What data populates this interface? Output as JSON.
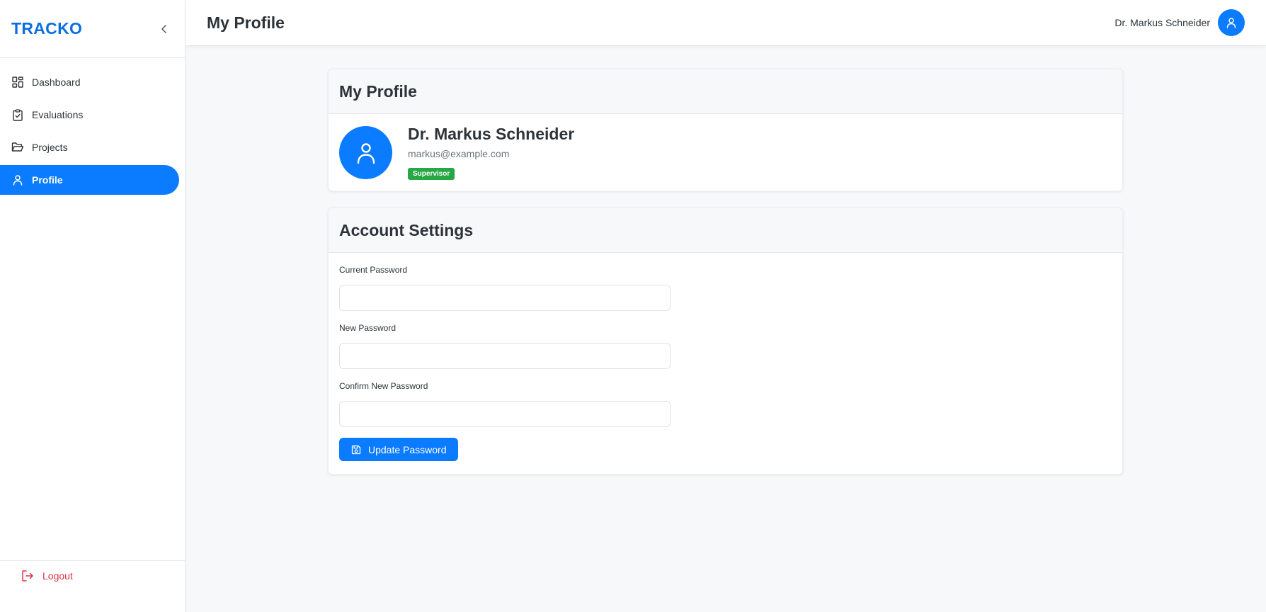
{
  "app": {
    "brand": "TRACKO"
  },
  "sidebar": {
    "items": [
      {
        "label": "Dashboard",
        "icon": "dashboard-icon",
        "active": false
      },
      {
        "label": "Evaluations",
        "icon": "clipboard-check-icon",
        "active": false
      },
      {
        "label": "Projects",
        "icon": "folder-open-icon",
        "active": false
      },
      {
        "label": "Profile",
        "icon": "user-icon",
        "active": true
      }
    ],
    "logout_label": "Logout"
  },
  "topbar": {
    "title": "My Profile",
    "user_name": "Dr. Markus Schneider"
  },
  "profile_card": {
    "title": "My Profile",
    "name": "Dr. Markus Schneider",
    "email": "markus@example.com",
    "role": "Supervisor"
  },
  "account_settings": {
    "title": "Account Settings",
    "fields": [
      {
        "label": "Current Password",
        "value": ""
      },
      {
        "label": "New Password",
        "value": ""
      },
      {
        "label": "Confirm New Password",
        "value": ""
      }
    ],
    "submit_label": "Update Password"
  },
  "colors": {
    "primary": "#0b7bff",
    "brand": "#0b6fe0",
    "success": "#28a745",
    "danger": "#dc3545"
  }
}
